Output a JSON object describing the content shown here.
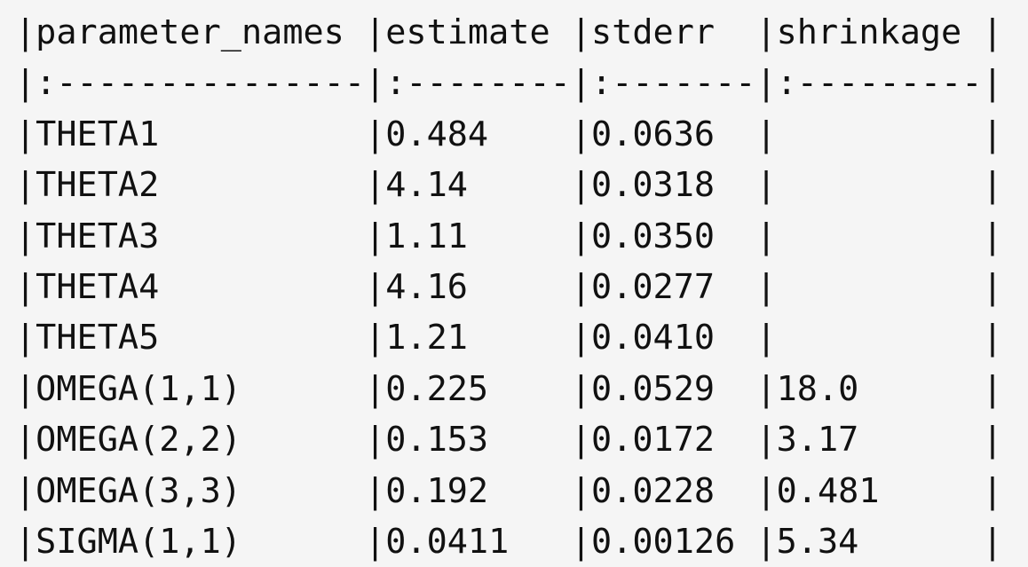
{
  "lines": [
    "|parameter_names |estimate |stderr  |shrinkage |",
    "|:---------------|:--------|:-------|:---------|",
    "|THETA1          |0.484    |0.0636  |          |",
    "|THETA2          |4.14     |0.0318  |          |",
    "|THETA3          |1.11     |0.0350  |          |",
    "|THETA4          |4.16     |0.0277  |          |",
    "|THETA5          |1.21     |0.0410  |          |",
    "|OMEGA(1,1)      |0.225    |0.0529  |18.0      |",
    "|OMEGA(2,2)      |0.153    |0.0172  |3.17      |",
    "|OMEGA(3,3)      |0.192    |0.0228  |0.481     |",
    "|SIGMA(1,1)      |0.0411   |0.00126 |5.34      |"
  ]
}
